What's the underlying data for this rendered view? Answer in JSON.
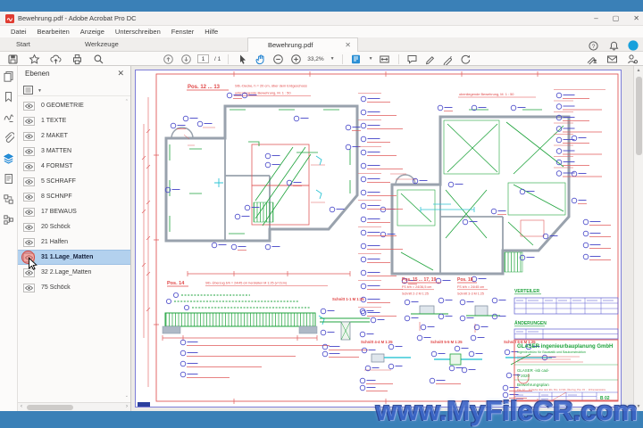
{
  "desktop": {
    "watermark": "www.MyFileCR.com"
  },
  "window": {
    "title": "Bewehrung.pdf - Adobe Acrobat Pro DC",
    "menu": {
      "items": [
        "Datei",
        "Bearbeiten",
        "Anzeige",
        "Unterschreiben",
        "Fenster",
        "Hilfe"
      ]
    },
    "tabs": {
      "start": "Start",
      "tools": "Werkzeuge",
      "document": "Bewehrung.pdf"
    },
    "toolbar": {
      "page_current": "1",
      "page_total": "/ 1",
      "zoom_level": "33,2%"
    }
  },
  "layers_panel": {
    "title": "Ebenen",
    "items": [
      "0 GEOMETRIE",
      "1 TEXTE",
      "2 MAKET",
      "3 MATTEN",
      "4 FORMST",
      "5 SCHRAFF",
      "8 SCHNPF",
      "17 BEWAUS",
      "20 Schöck",
      "21 Halfen",
      "31 1.Lage_Matten",
      "32 2.Lage_Matten",
      "75 Schöck"
    ],
    "selected_index": 10
  },
  "drawing": {
    "pos12_title": "Pos. 12 ... 13",
    "pos12_sub1": "Stb.-Decke, h = 20 cm, über dem Erdgeschoss",
    "pos12_sub2": "untenliegende Bewehrung, M. 1 : 50",
    "right_plan_title": "obenliegende Bewehrung, M. 1 : 50",
    "pos14_title": "Pos. 14",
    "pos14_sub": "Stb.-Überzug b/h = 24/45 cm   herstellen   M 1:25 (v=2cm)",
    "schnitt11": "Schnitt 1-1   M 1:25",
    "pos15_title": "Pos. 15 ... 17, 19",
    "pos15_sub1": "FS b/h = 24/36,5 cm",
    "pos15_sub2": "Schnitt 2-2   M 1:25",
    "pos18_title": "Pos. 18",
    "pos18_sub1": "FS b/h = 24/45 cm",
    "pos18_sub2": "Schnitt 3-3   M 1:25",
    "schnitt44": "Schnitt 4-4   M 1:25",
    "schnitt55": "Schnitt 5-5   M 1:25",
    "schnitt66": "Schnitt 6-6   M 1:25",
    "verteiler": "VERTEILER",
    "aenderungen": "ÄNDERUNGEN",
    "titleblock": {
      "company": "GLASER ingenieurbauplanung GmbH",
      "subtitle": "Ingenieurbüro für Baustatik und Baukonstruktion",
      "software": "GLASER -isb cad-",
      "version": "V 2020",
      "plan_type": "Bewehrungsplan",
      "plan_desc": "Pos. 12 ... 13 Decke über dem EG, Pos. 14 Stb.-Überzug, Pos. 15 ... 19 Fensterstürze",
      "sheet": "B 02"
    }
  },
  "colors": {
    "accent_blue": "#0f7fd4",
    "drawing_red": "#e05a5a",
    "drawing_green": "#1fa33c",
    "annotation_blue": "#4646c8",
    "selection": "#b3d1ee",
    "desktop_strip": "#3a80b7"
  }
}
